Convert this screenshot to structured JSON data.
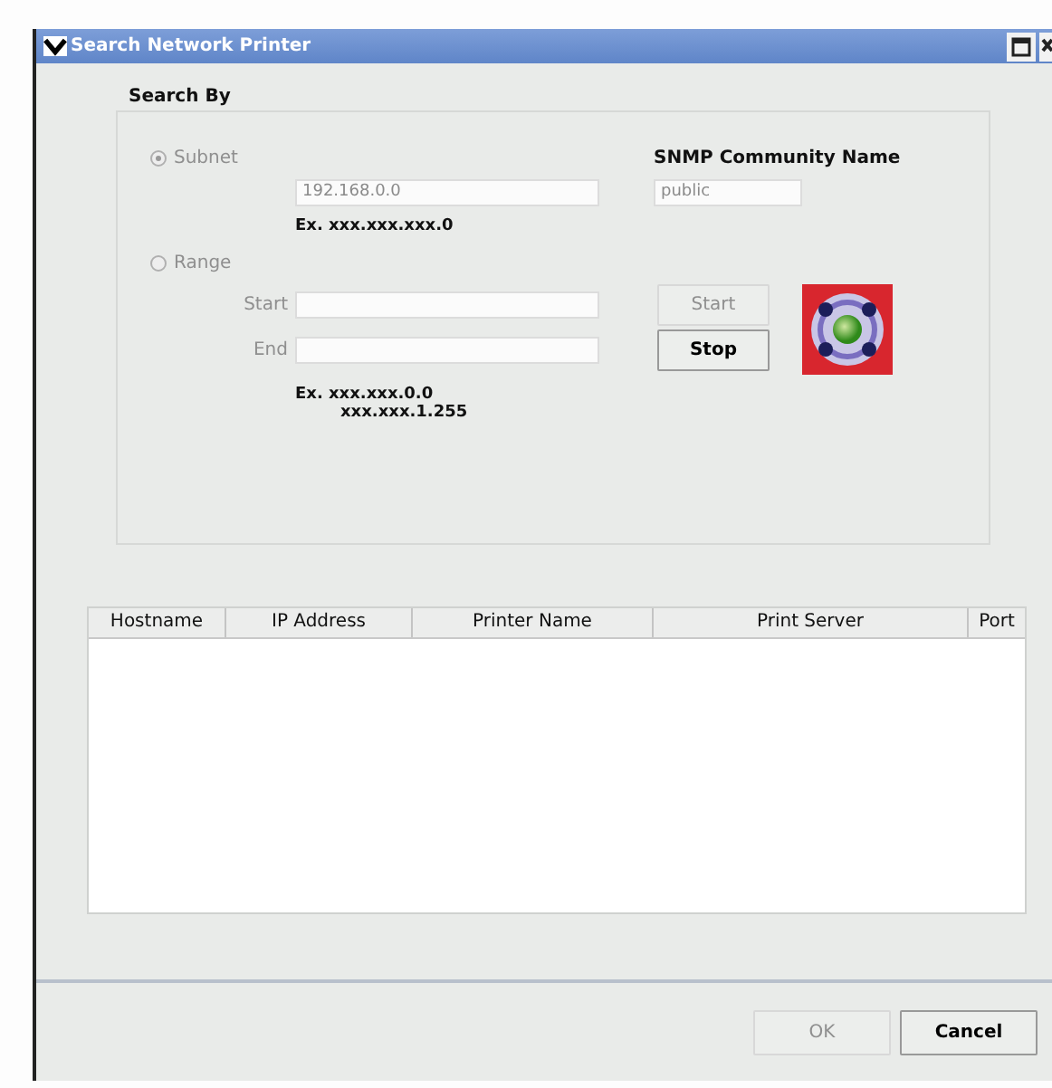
{
  "window": {
    "title": "Search Network Printer"
  },
  "search_by": {
    "title": "Search By",
    "modes": [
      {
        "label": "Subnet",
        "selected": true,
        "disabled": true
      },
      {
        "label": "Range",
        "selected": false,
        "disabled": true
      }
    ],
    "subnet": {
      "value": "192.168.0.0",
      "disabled": true,
      "example": "Ex.  xxx.xxx.xxx.0"
    },
    "community": {
      "label": "SNMP Community Name",
      "value": "public",
      "disabled": true
    },
    "range": {
      "start_label": "Start",
      "end_label": "End",
      "disabled": true,
      "example_lines": [
        "Ex.  xxx.xxx.0.0",
        "xxx.xxx.1.255"
      ]
    },
    "buttons": [
      {
        "label": "Start",
        "disabled": true
      },
      {
        "label": "Stop",
        "disabled": false
      }
    ]
  },
  "table": {
    "columns": [
      "Hostname",
      "IP Address",
      "Printer Name",
      "Print Server",
      "Port"
    ]
  },
  "buttons": [
    {
      "label": "OK",
      "disabled": true
    },
    {
      "label": "Cancel",
      "disabled": false
    }
  ]
}
